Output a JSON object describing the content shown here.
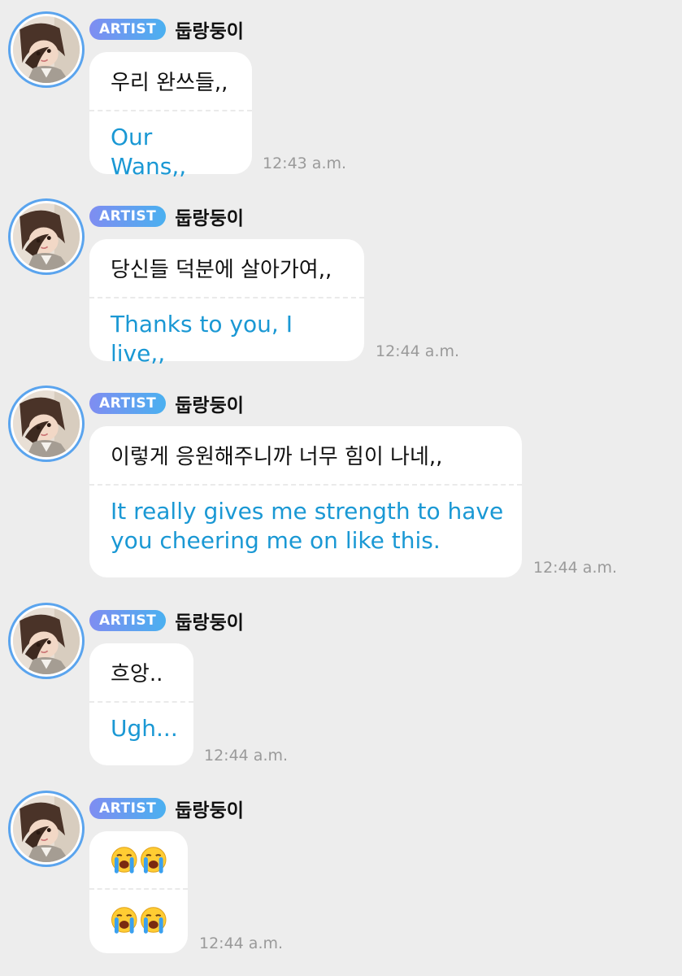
{
  "messages": [
    {
      "badge": "ARTIST",
      "name": "둡랑둥이",
      "korean": "우리 완쓰들,,",
      "english": "Our Wans,,",
      "time": "12:43 a.m."
    },
    {
      "badge": "ARTIST",
      "name": "둡랑둥이",
      "korean": "당신들 덕분에 살아가여,,",
      "english": "Thanks to you, I live,,",
      "time": "12:44 a.m."
    },
    {
      "badge": "ARTIST",
      "name": "둡랑둥이",
      "korean": "이렇게 응원해주니까 너무 힘이 나네,,",
      "english_line1": "It really gives me strength to have",
      "english_line2": "you cheering me on like this.",
      "time": "12:44 a.m."
    },
    {
      "badge": "ARTIST",
      "name": "둡랑둥이",
      "korean": "흐앙..",
      "english": "Ugh...",
      "time": "12:44 a.m."
    },
    {
      "badge": "ARTIST",
      "name": "둡랑둥이",
      "emoji_icon": "loudly-crying-face-icon",
      "emoji_count_top": 2,
      "emoji_count_bottom": 2,
      "time": "12:44 a.m."
    }
  ],
  "colors": {
    "background": "#ededed",
    "bubble": "#ffffff",
    "translation_text": "#1a98d4",
    "badge_start": "#7f8df1",
    "badge_end": "#4ab0f0",
    "avatar_ring": "#5aa4ee",
    "timestamp": "#9a9a9a"
  }
}
